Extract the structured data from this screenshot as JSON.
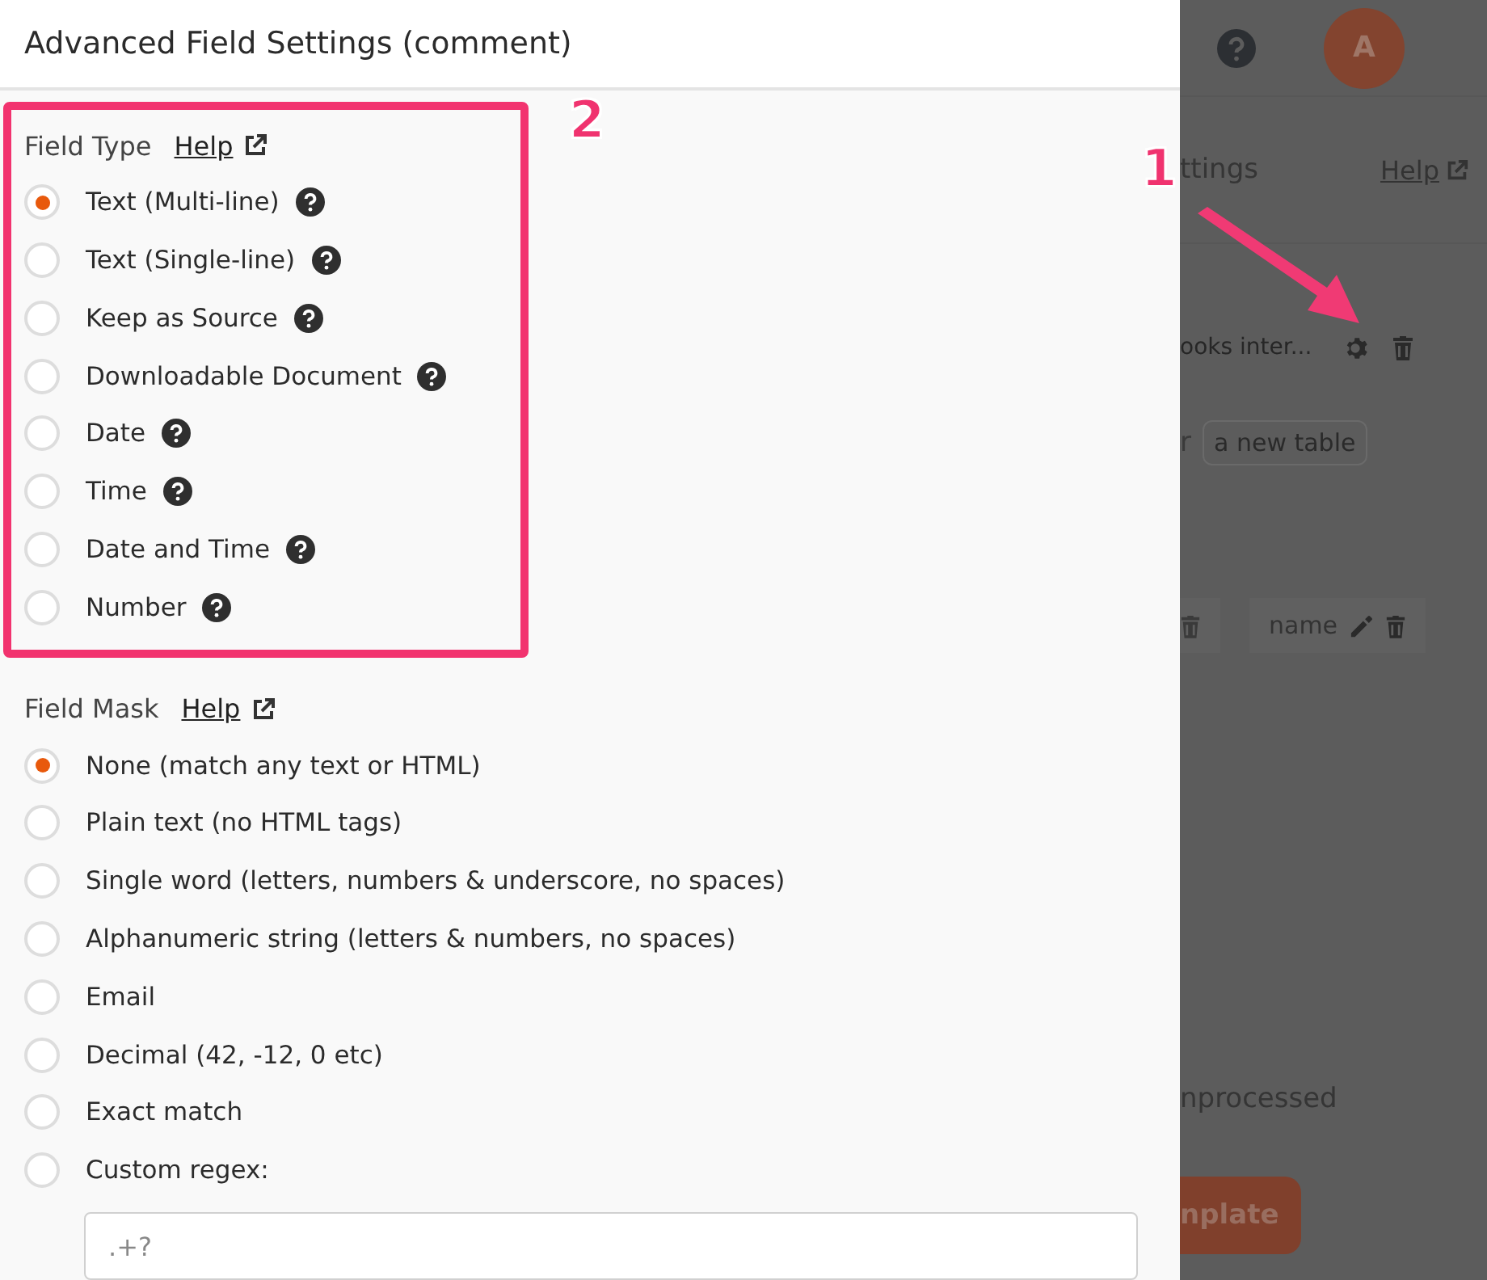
{
  "dialog": {
    "title": "Advanced Field Settings (comment)",
    "sections": [
      {
        "label": "Field Type",
        "help_link": "Help",
        "highlighted": true,
        "options": [
          {
            "label": "Text (Multi-line)",
            "selected": true,
            "has_help": true
          },
          {
            "label": "Text (Single-line)",
            "selected": false,
            "has_help": true
          },
          {
            "label": "Keep as Source",
            "selected": false,
            "has_help": true
          },
          {
            "label": "Downloadable Document",
            "selected": false,
            "has_help": true
          },
          {
            "label": "Date",
            "selected": false,
            "has_help": true
          },
          {
            "label": "Time",
            "selected": false,
            "has_help": true
          },
          {
            "label": "Date and Time",
            "selected": false,
            "has_help": true
          },
          {
            "label": "Number",
            "selected": false,
            "has_help": true
          }
        ]
      },
      {
        "label": "Field Mask",
        "help_link": "Help",
        "highlighted": false,
        "options": [
          {
            "label": "None (match any text or HTML)",
            "selected": true,
            "has_help": false
          },
          {
            "label": "Plain text (no HTML tags)",
            "selected": false,
            "has_help": false
          },
          {
            "label": "Single word (letters, numbers & underscore, no spaces)",
            "selected": false,
            "has_help": false
          },
          {
            "label": "Alphanumeric string (letters & numbers, no spaces)",
            "selected": false,
            "has_help": false
          },
          {
            "label": "Email",
            "selected": false,
            "has_help": false
          },
          {
            "label": "Decimal (42, -12, 0 etc)",
            "selected": false,
            "has_help": false
          },
          {
            "label": "Exact match",
            "selected": false,
            "has_help": false
          },
          {
            "label": "Custom regex:",
            "selected": false,
            "has_help": false
          }
        ]
      }
    ],
    "regex_field": {
      "placeholder": ".+?"
    }
  },
  "background": {
    "avatar": "A",
    "settings_title": "ttings",
    "help_link": "Help",
    "field_name": "ooks inter...",
    "table_label": "r",
    "table_chip": "a new table",
    "column_chip": "name",
    "status": "nprocessed",
    "button": "nplate"
  },
  "annotations": [
    {
      "number": "1"
    },
    {
      "number": "2"
    }
  ]
}
